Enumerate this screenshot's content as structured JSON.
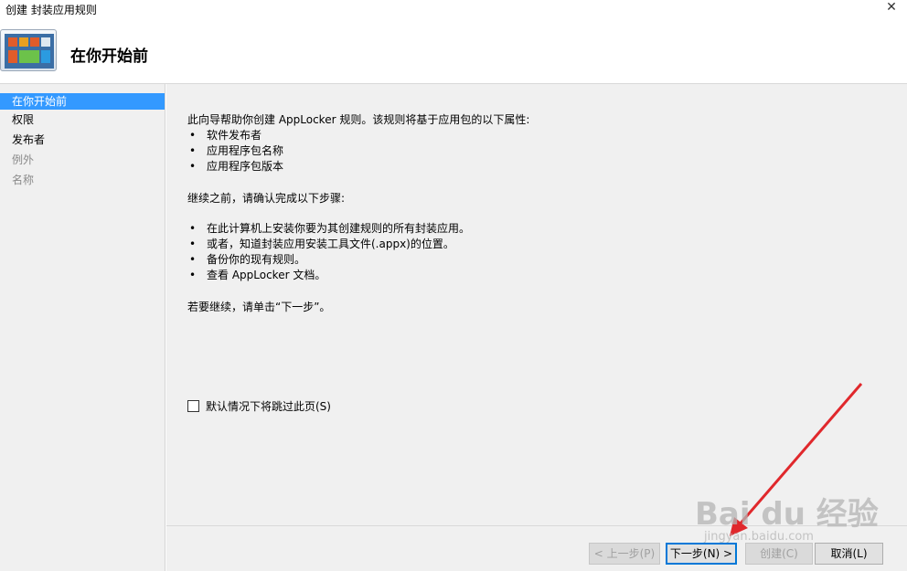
{
  "window": {
    "title": "创建 封装应用规则",
    "close_glyph": "✕"
  },
  "header": {
    "heading": "在你开始前",
    "icon": "app-package-icon"
  },
  "sidebar": {
    "items": [
      {
        "label": "在你开始前",
        "state": "active"
      },
      {
        "label": "权限",
        "state": "enabled"
      },
      {
        "label": "发布者",
        "state": "enabled"
      },
      {
        "label": "例外",
        "state": "disabled"
      },
      {
        "label": "名称",
        "state": "disabled"
      }
    ]
  },
  "main": {
    "intro": "此向导帮助你创建 AppLocker 规则。该规则将基于应用包的以下属性:",
    "properties": [
      "软件发布者",
      "应用程序包名称",
      "应用程序包版本"
    ],
    "before_text": "继续之前，请确认完成以下步骤:",
    "steps": [
      "在此计算机上安装你要为其创建规则的所有封装应用。",
      "或者，知道封装应用安装工具文件(.appx)的位置。",
      "备份你的现有规则。",
      "查看 AppLocker 文档。"
    ],
    "continue_text": "若要继续，请单击“下一步”。",
    "skip_checkbox_label": "默认情况下将跳过此页(S)",
    "skip_checked": false
  },
  "footer": {
    "prev_label": "< 上一步(P)",
    "next_label": "下一步(N) >",
    "create_label": "创建(C)",
    "cancel_label": "取消(L)"
  },
  "watermark": {
    "text": "Bai du 经验",
    "sub": "jingyan.baidu.com"
  },
  "colors": {
    "selection": "#3399ff",
    "annotation_arrow": "#e0282c"
  }
}
